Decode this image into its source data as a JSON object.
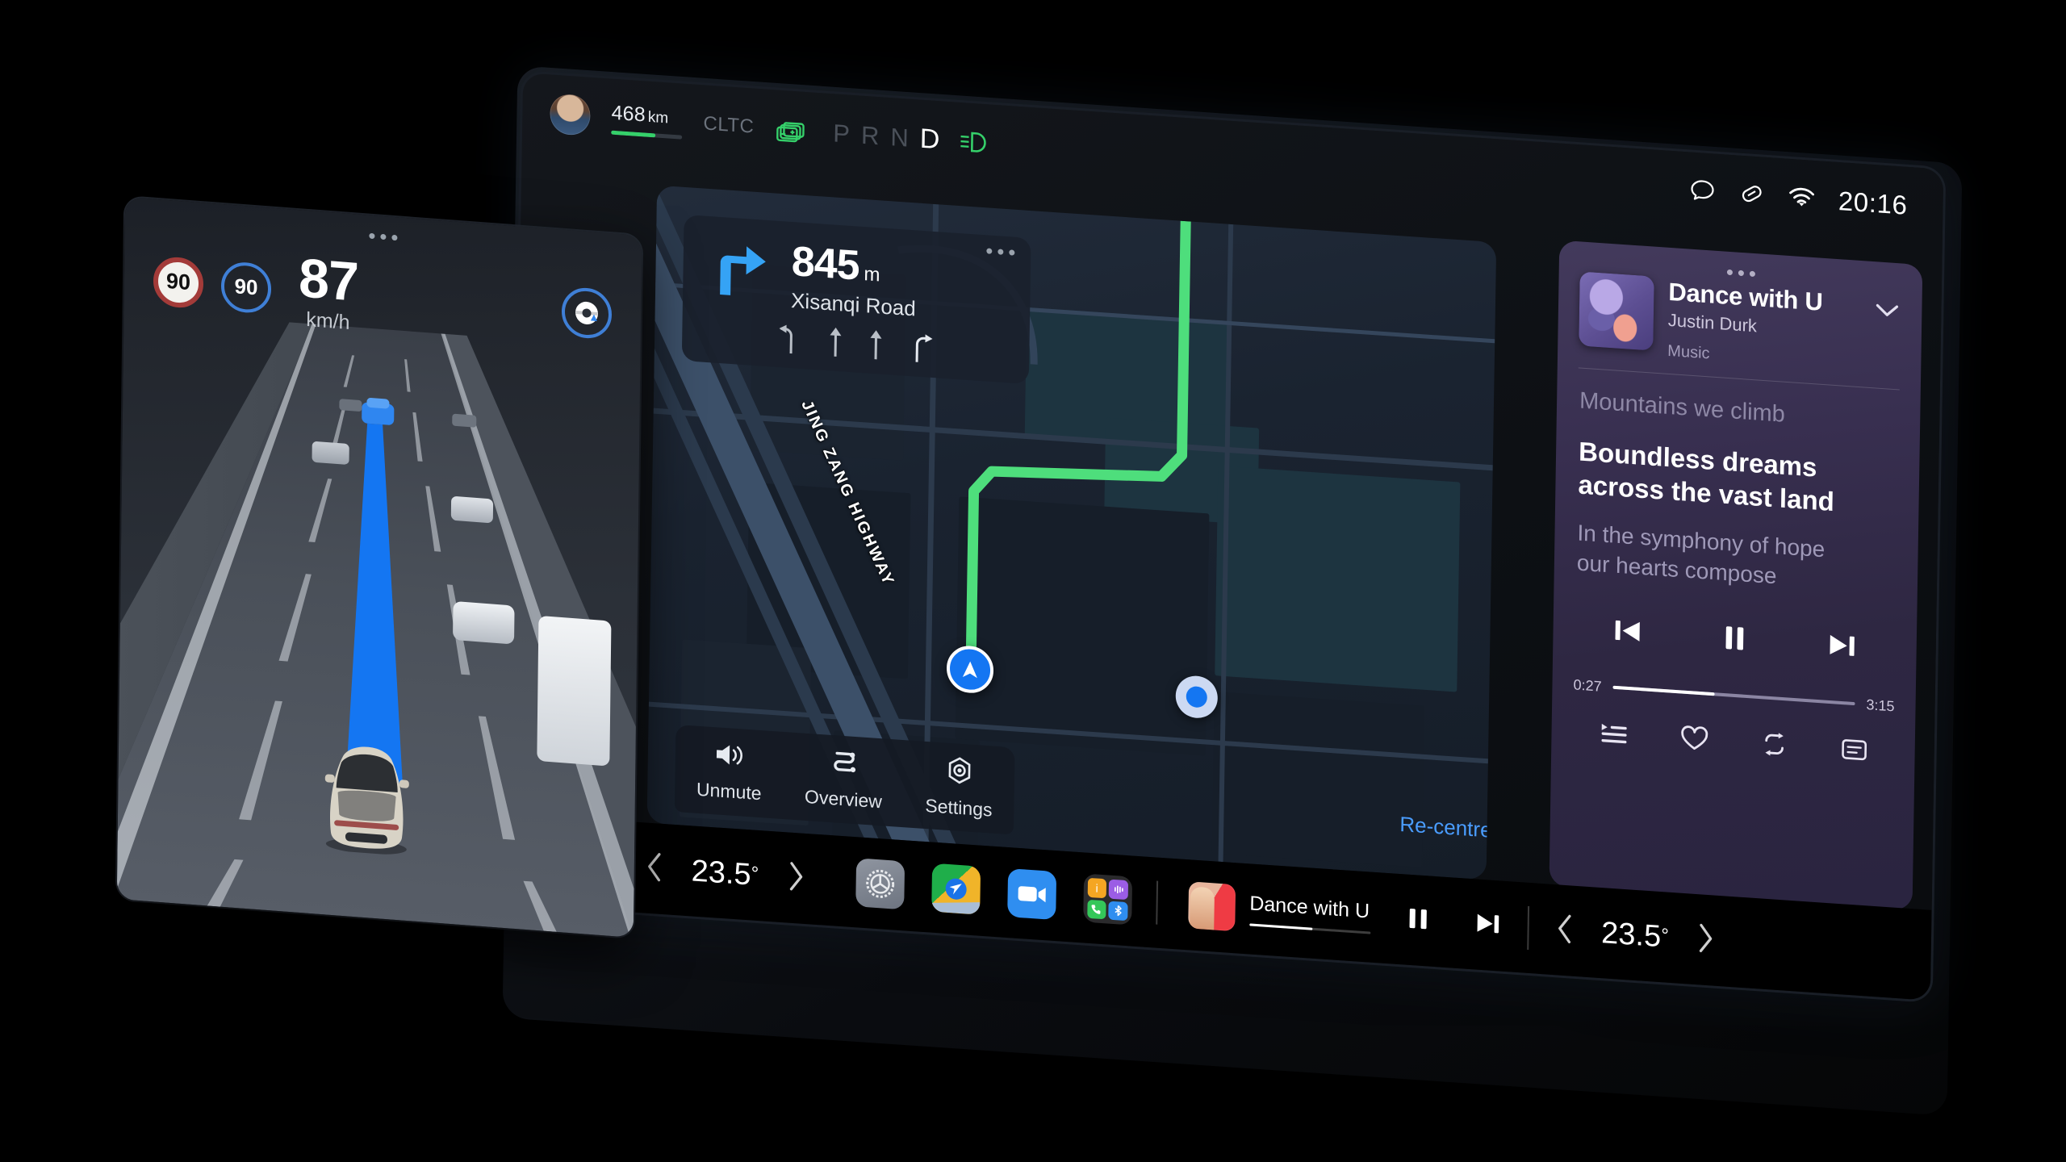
{
  "status_bar": {
    "range_value": "468",
    "range_unit": "km",
    "standard": "CLTC",
    "battery_icon": "battery-icon",
    "gear_p": "P",
    "gear_r": "R",
    "gear_n": "N",
    "gear_d": "D",
    "active_gear": "D",
    "headlight_icon": "low-beam-icon",
    "message_icon": "message-bubble-icon",
    "link_icon": "link-icon",
    "wifi_icon": "wifi-icon",
    "clock": "20:16",
    "battery_percent": 62
  },
  "driving_display": {
    "speed_limit": "90",
    "cruise_speed": "90",
    "current_speed": "87",
    "speed_unit": "km/h",
    "adas_icon": "steering-wheel-assist-icon",
    "menu_icon": "more-dots-icon"
  },
  "navigation": {
    "menu_icon": "more-dots-icon",
    "turn_icon": "turn-right-arrow-icon",
    "distance_value": "845",
    "distance_unit": "m",
    "street": "Xisanqi Road",
    "lanes": [
      "lane-left-turn",
      "lane-straight",
      "lane-straight",
      "lane-right-turn"
    ],
    "highway_label": "JING ZANG HIGHWAY",
    "vehicle_marker": "vehicle-heading-marker",
    "recentre_label": "Re-centre",
    "controls": [
      {
        "label": "Unmute",
        "icon": "speaker-icon"
      },
      {
        "label": "Overview",
        "icon": "route-overview-icon"
      },
      {
        "label": "Settings",
        "icon": "gear-hex-icon"
      }
    ]
  },
  "music_panel": {
    "menu_icon": "more-dots-icon",
    "album_art": "album-art-thumbnail",
    "title": "Dance with U",
    "artist": "Justin Durk",
    "source": "Music",
    "collapse_icon": "chevron-down-icon",
    "lyrics_previous": "Mountains we climb",
    "lyrics_current_line1": "Boundless dreams",
    "lyrics_current_line2": "across the vast land",
    "lyrics_next_line1": "In the symphony of hope",
    "lyrics_next_line2": "our hearts compose",
    "prev_icon": "previous-track-icon",
    "play_icon": "pause-icon",
    "next_icon": "next-track-icon",
    "elapsed": "0:27",
    "duration": "3:15",
    "progress_percent": 42,
    "bottom_icons": [
      "playlist-icon",
      "heart-icon",
      "repeat-icon",
      "lyrics-icon"
    ]
  },
  "taskbar": {
    "home_icon": "home-icon",
    "driver_temp": "23.5",
    "driver_temp_unit": "°",
    "passenger_temp": "23.5",
    "passenger_temp_unit": "°",
    "temp_prev_icon": "chevron-left-icon",
    "temp_next_icon": "chevron-right-icon",
    "apps": [
      {
        "name": "settings-app",
        "icon": "car-settings-icon"
      },
      {
        "name": "maps-app",
        "icon": "navigation-arrow-icon"
      },
      {
        "name": "video-app",
        "icon": "video-camera-icon"
      },
      {
        "name": "app-folder",
        "icon": "folder-icon"
      }
    ],
    "folder_mini": [
      "info-icon",
      "voice-icon",
      "phone-icon",
      "bluetooth-icon"
    ],
    "now_playing_title": "Dance with U",
    "now_playing_progress": 52,
    "pause_icon": "pause-icon",
    "next_icon": "next-track-icon"
  },
  "colors": {
    "accent_blue": "#1476f2",
    "route_green": "#4ede7c",
    "battery_green": "#35d06a",
    "speed_limit_red": "#a33b39",
    "link_blue": "#4a9dff"
  }
}
